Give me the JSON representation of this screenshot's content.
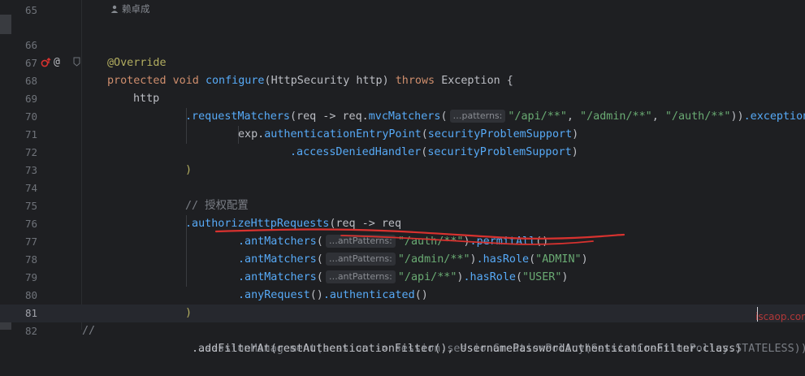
{
  "editor": {
    "author_hint": "赖卓成",
    "current_line": "81",
    "lines": [
      {
        "num": "65",
        "code": ""
      },
      {
        "num": "66",
        "code": "@Override"
      },
      {
        "num": "67",
        "code": "protected void configure(HttpSecurity http) throws Exception {"
      },
      {
        "num": "68",
        "code": "http"
      },
      {
        "num": "69",
        "code": ".requestMatchers(req -> req.mvcMatchers( …patterns: \"/api/**\", \"/admin/**\", \"/auth/**\")).exception"
      },
      {
        "num": "70",
        "code": "exp.authenticationEntryPoint(securityProblemSupport)"
      },
      {
        "num": "71",
        "code": ".accessDeniedHandler(securityProblemSupport)"
      },
      {
        "num": "72",
        "code": ")"
      },
      {
        "num": "73",
        "code": ""
      },
      {
        "num": "74",
        "code": "// 授权配置"
      },
      {
        "num": "75",
        "code": ".authorizeHttpRequests(req -> req"
      },
      {
        "num": "76",
        "code": ".antMatchers( …antPatterns: \"/auth/**\").permitAll()"
      },
      {
        "num": "77",
        "code": ".antMatchers( …antPatterns: \"/admin/**\").hasRole(\"ADMIN\")"
      },
      {
        "num": "78",
        "code": ".antMatchers( …antPatterns: \"/api/**\").hasRole(\"USER\")"
      },
      {
        "num": "79",
        "code": ".anyRequest().authenticated()"
      },
      {
        "num": "80",
        "code": ")"
      },
      {
        "num": "81",
        "code": "//          .sessionManagement(session -> session.sessionCreationPolicy(SessionCreationPolicy.STATELESS))"
      },
      {
        "num": "82",
        "code": ".addFilterAt(restAuthenticationFilter(), UsernamePasswordAuthenticationFilter.class)"
      }
    ],
    "tokens": {
      "override": "@Override",
      "protected": "protected",
      "void": "void",
      "configure": "configure",
      "httpsecurity": "HttpSecurity",
      "http_param": "http",
      "throws": "throws",
      "exception": "Exception",
      "http": "http",
      "request_matchers": ".requestMatchers",
      "req_arrow": "(req -> req.",
      "mvc_matchers": "mvcMatchers",
      "patterns_hint": "…patterns:",
      "api_str": "\"/api/**\"",
      "admin_str": "\"/admin/**\"",
      "auth_str": "\"/auth/**\"",
      "exception_tail": ".exception",
      "exp": "exp.",
      "entry_point": "authenticationEntryPoint",
      "problem_support": "securityProblemSupport",
      "access_denied": ".accessDeniedHandler",
      "close_paren": ")",
      "comment_auth": "// 授权配置",
      "authorize": ".authorizeHttpRequests",
      "req_lambda": "(req -> req",
      "ant_matchers": ".antMatchers",
      "ant_hint": "…antPatterns:",
      "permit_all": ".permitAll",
      "has_role": ".hasRole",
      "admin_role": "\"ADMIN\"",
      "user_role": "\"USER\"",
      "any_request": ".anyRequest",
      "authenticated": ".authenticated",
      "comment_slashes": "//",
      "session_mgmt": ".sessionManagement(session -> session.sessionCreationPolicy(SessionCreationPolicy.STATELESS))",
      "add_filter": ".addFilterAt(restAuthenticationFilter(), UsernamePasswordAuthenticationFilter.class)"
    },
    "watermark": "iscaop.com"
  },
  "colors": {
    "background": "#1e1f22",
    "keyword": "#cf8e6d",
    "annotation": "#b3ae60",
    "method": "#57aaf7",
    "string": "#6aab73",
    "comment": "#7a7e85",
    "annotation_mark": "#d8322f"
  },
  "icons": {
    "gutter_67": [
      "override-method-icon",
      "at-annotation-icon",
      "fold-icon"
    ],
    "author": "user-icon"
  }
}
